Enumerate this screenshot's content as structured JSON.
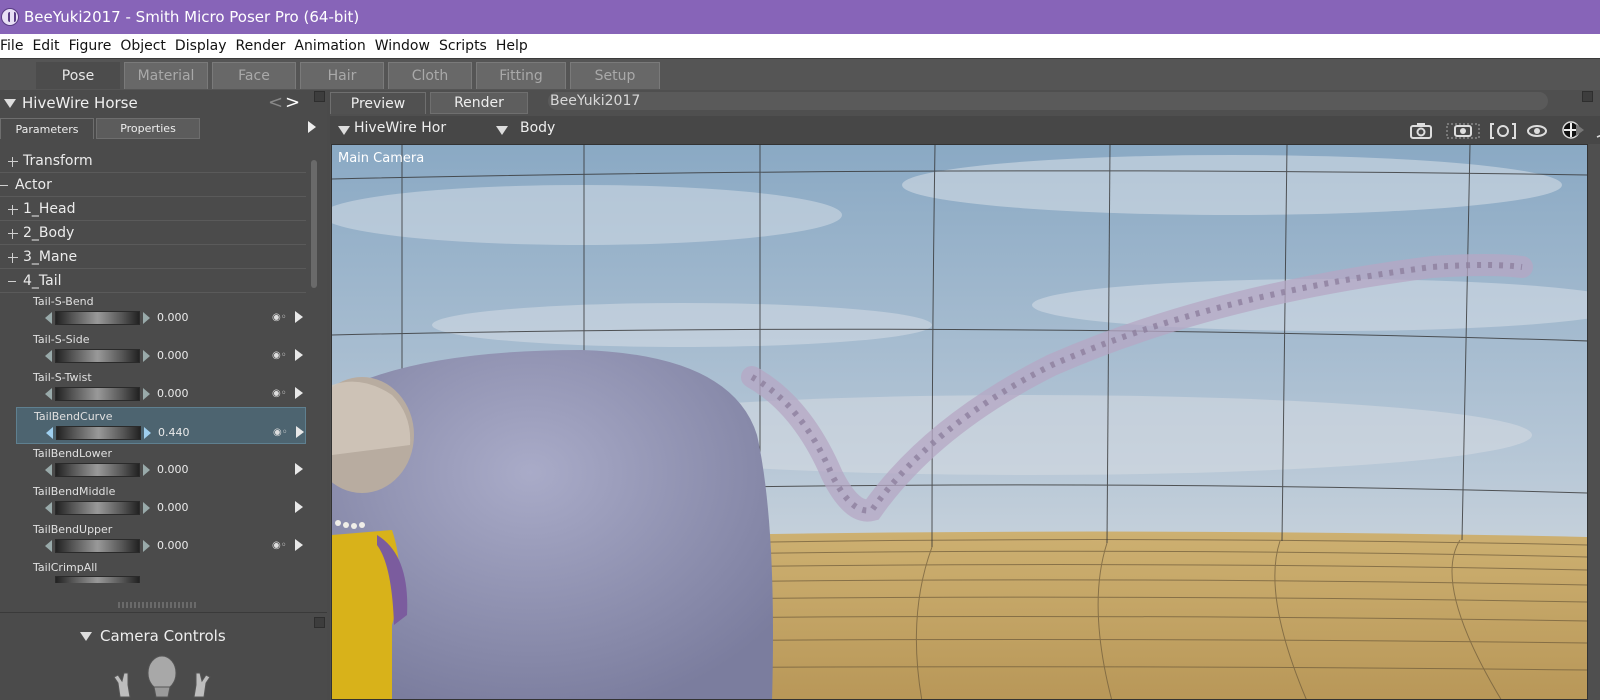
{
  "window": {
    "title": "BeeYuki2017 - Smith Micro Poser Pro  (64-bit)"
  },
  "menu": [
    "File",
    "Edit",
    "Figure",
    "Object",
    "Display",
    "Render",
    "Animation",
    "Window",
    "Scripts",
    "Help"
  ],
  "rooms": [
    "Pose",
    "Material",
    "Face",
    "Hair",
    "Cloth",
    "Fitting",
    "Setup"
  ],
  "left_panel": {
    "figure_name": "HiveWire Horse",
    "tabs": [
      "Parameters",
      "Properties"
    ],
    "groups": [
      {
        "label": "Transform",
        "state": "collapsed"
      },
      {
        "label": "Actor",
        "state": "expanded"
      },
      {
        "label": "1_Head",
        "state": "collapsed"
      },
      {
        "label": "2_Body",
        "state": "collapsed"
      },
      {
        "label": "3_Mane",
        "state": "collapsed"
      },
      {
        "label": "4_Tail",
        "state": "expanded"
      }
    ],
    "params": [
      {
        "name": "Tail-S-Bend",
        "value": "0.000",
        "selected": false,
        "keyed": true
      },
      {
        "name": "Tail-S-Side",
        "value": "0.000",
        "selected": false,
        "keyed": true
      },
      {
        "name": "Tail-S-Twist",
        "value": "0.000",
        "selected": false,
        "keyed": true
      },
      {
        "name": "TailBendCurve",
        "value": "0.440",
        "selected": true,
        "keyed": true
      },
      {
        "name": "TailBendLower",
        "value": "0.000",
        "selected": false,
        "keyed": false
      },
      {
        "name": "TailBendMiddle",
        "value": "0.000",
        "selected": false,
        "keyed": false
      },
      {
        "name": "TailBendUpper",
        "value": "0.000",
        "selected": false,
        "keyed": true
      },
      {
        "name": "TailCrimpAll",
        "value": "",
        "selected": false,
        "keyed": false
      }
    ],
    "camera_controls_label": "Camera Controls"
  },
  "document": {
    "tabs": [
      "Preview",
      "Render"
    ],
    "title": "BeeYuki2017",
    "figure_select": "HiveWire Hor",
    "actor_select": "Body",
    "camera_label": "Main Camera"
  },
  "colors": {
    "titlebar": "#8764b8",
    "selected_param": "#4d6470",
    "sky": "#9ab5cc",
    "floor": "#c7a464"
  }
}
